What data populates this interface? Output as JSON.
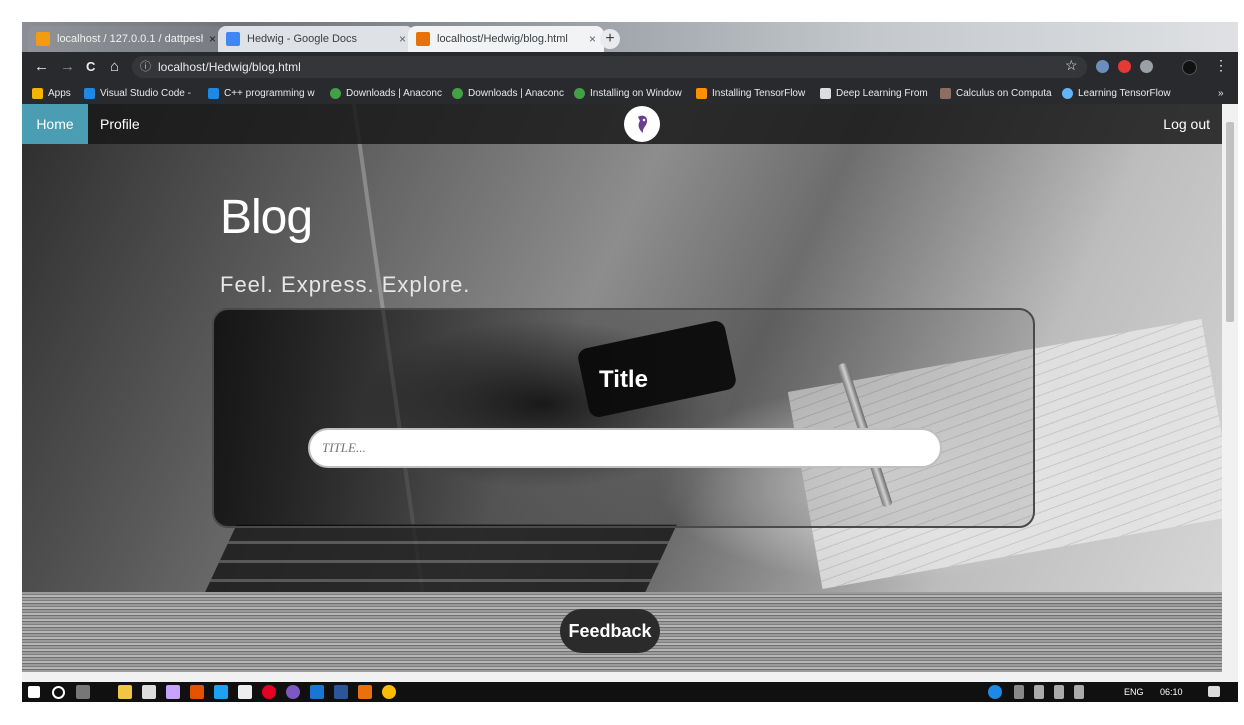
{
  "browser": {
    "tabs": [
      {
        "title": "localhost / 127.0.0.1 / dattpesh y...",
        "close": "×",
        "icon_color": "#f39c12"
      },
      {
        "title": "Hedwig - Google Docs",
        "close": "×",
        "icon_color": "#4285f4"
      },
      {
        "title": "localhost/Hedwig/blog.html",
        "close": "×",
        "icon_color": "#e8710a"
      }
    ],
    "new_tab": "+",
    "back": "←",
    "forward": "→",
    "reload": "C",
    "home": "⌂",
    "info": "ⓘ",
    "address": "localhost/Hedwig/blog.html",
    "star": "☆",
    "menu": "⋮",
    "bookmarks": [
      "Apps",
      "Visual Studio Code -",
      "C++ programming w",
      "Downloads | Anaconc",
      "Downloads | Anaconc",
      "Installing on Window",
      "Installing TensorFlow",
      "Deep Learning From",
      "Calculus on Computa",
      "Learning TensorFlow"
    ],
    "bookmarks_more": "»"
  },
  "site": {
    "nav": {
      "home": "Home",
      "profile": "Profile",
      "logout": "Log out"
    },
    "hero": {
      "title": "Blog",
      "subtitle": "Feel.  Express.  Explore."
    },
    "form": {
      "label": "Title",
      "placeholder": "TITLE..."
    },
    "footer": {
      "feedback": "Feedback"
    }
  },
  "taskbar": {
    "language": "ENG",
    "time": "06:10"
  },
  "colors": {
    "nav_active": "#4a9db2",
    "chrome_dark": "#292a2d"
  }
}
